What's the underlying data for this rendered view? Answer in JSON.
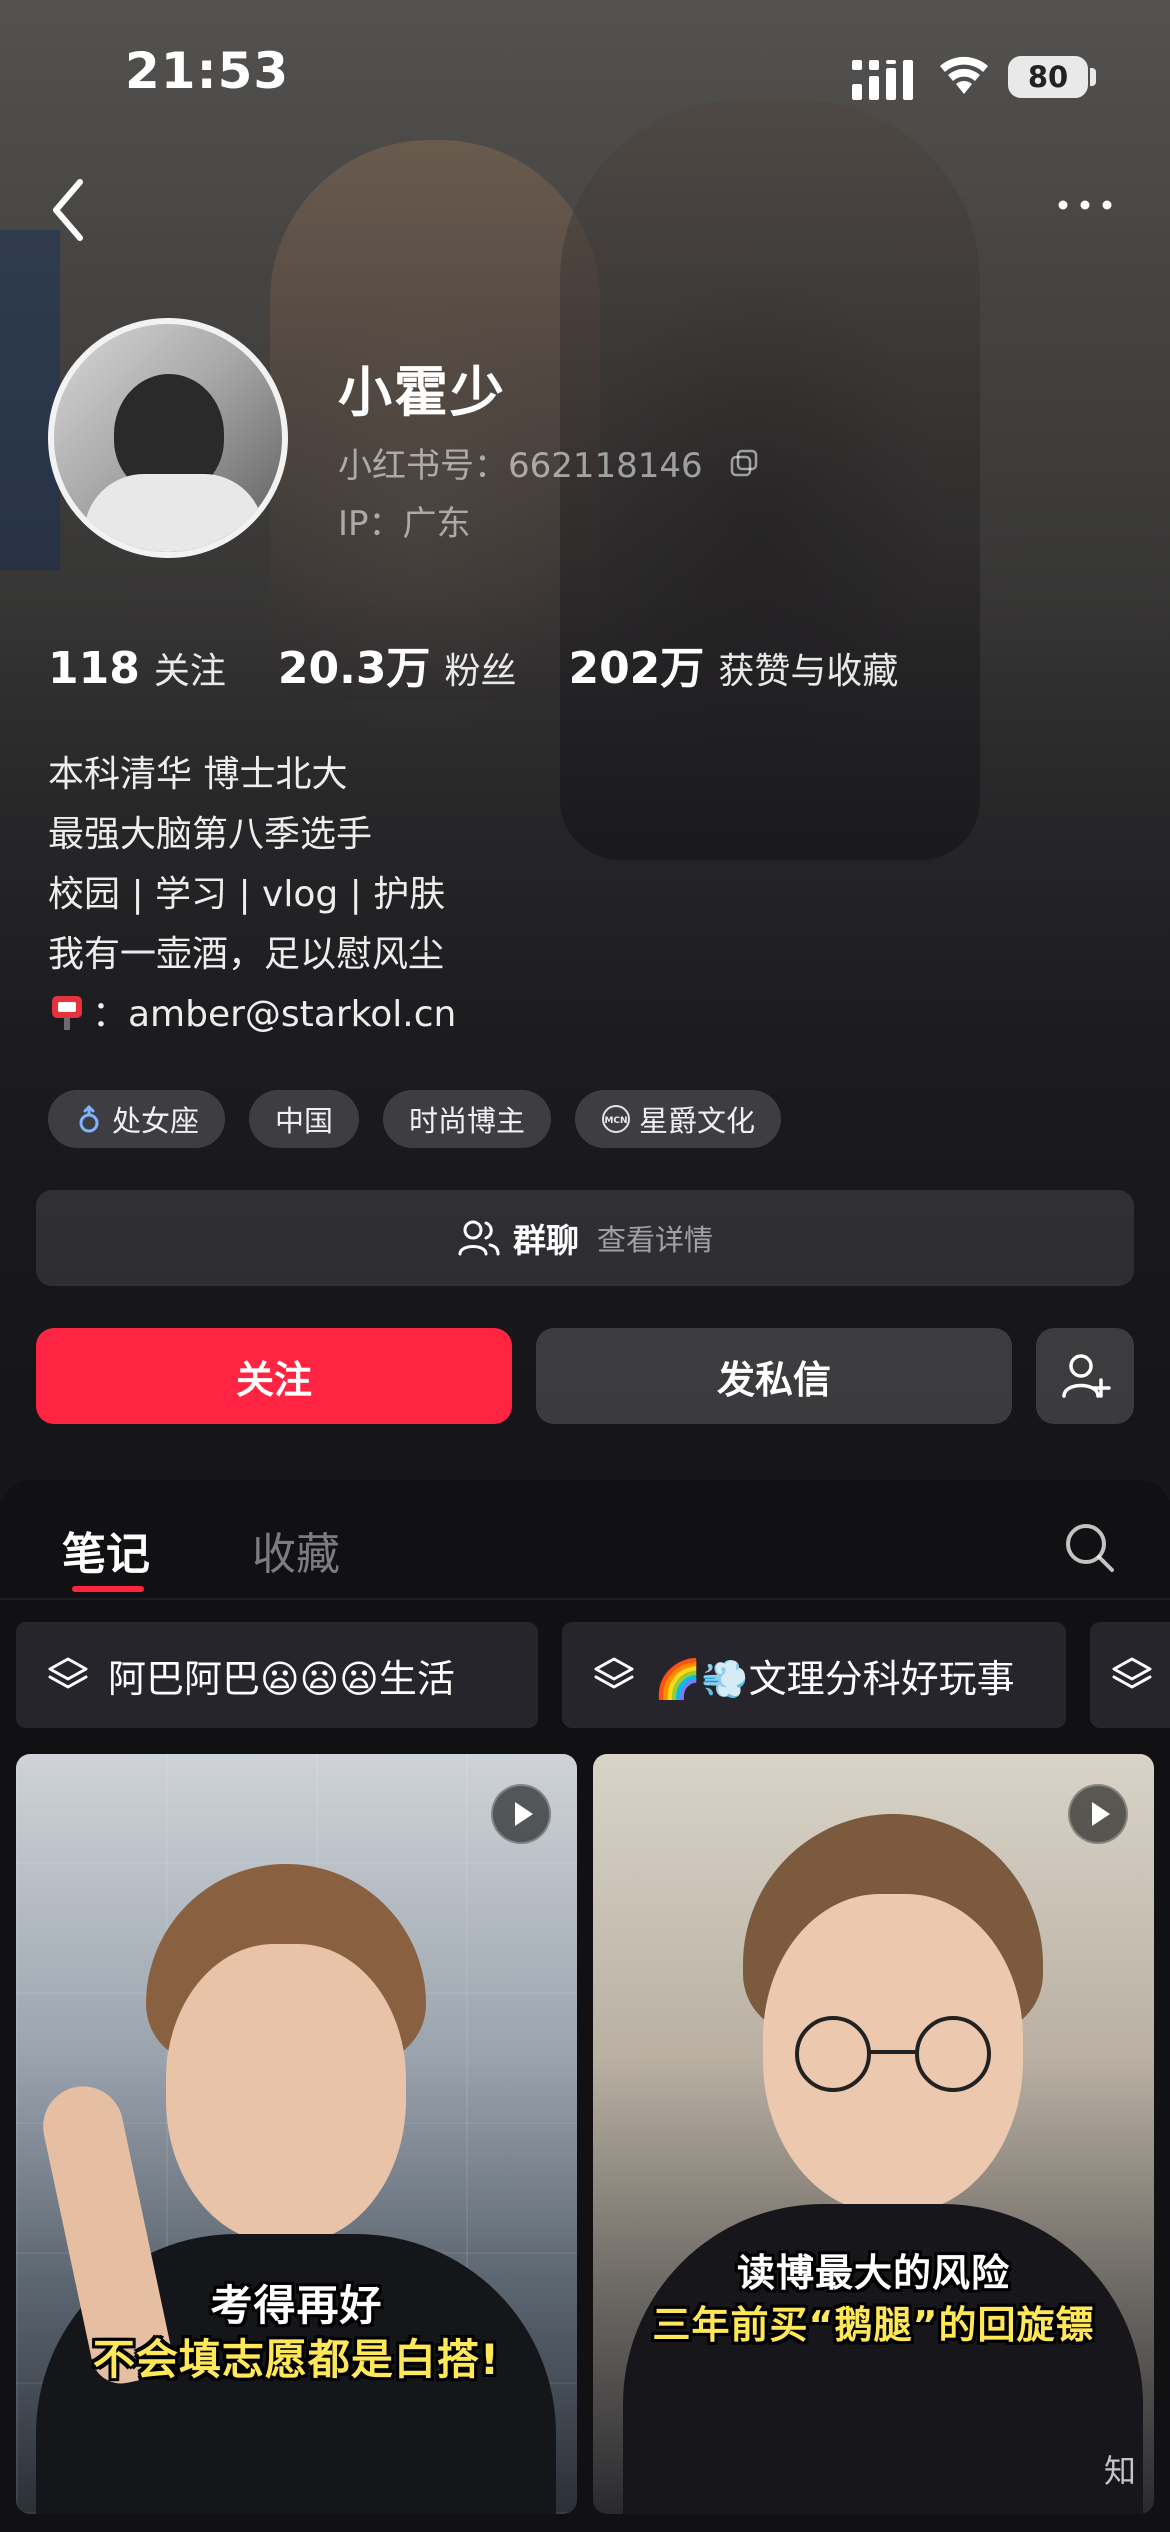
{
  "status_bar": {
    "time": "21:53",
    "battery": "80"
  },
  "profile": {
    "nickname": "小霍少",
    "red_id": "小红书号：662118146",
    "ip": "IP：广东",
    "stats": [
      {
        "value": "118",
        "label": "关注"
      },
      {
        "value": "20.3万",
        "label": "粉丝"
      },
      {
        "value": "202万",
        "label": "获赞与收藏"
      }
    ],
    "bio": [
      "本科清华 博士北大",
      "最强大脑第八季选手",
      "校园 | 学习 | vlog | 护肤",
      "我有一壶酒，足以慰风尘"
    ],
    "email": "：amber@starkol.cn",
    "tags": [
      {
        "label": "处女座",
        "icon": "virgo-icon"
      },
      {
        "label": "中国",
        "icon": ""
      },
      {
        "label": "时尚博主",
        "icon": ""
      },
      {
        "label": "星爵文化",
        "icon": "mcn-icon"
      }
    ],
    "group_chat": {
      "title": "群聊",
      "detail": "查看详情"
    },
    "actions": {
      "follow": "关注",
      "message": "发私信"
    }
  },
  "content": {
    "tabs": [
      "笔记",
      "收藏"
    ],
    "active_tab": "笔记",
    "collections": [
      "阿巴阿巴😦😦😦生活",
      "🌈💨文理分科好玩事"
    ],
    "notes": [
      {
        "caption_line1": "考得再好",
        "caption_line2": "不会填志愿都是白搭!",
        "type": "video"
      },
      {
        "caption_line1": "读博最大的风险",
        "caption_line2": "三年前买“鹅腿”的回旋镖",
        "type": "video",
        "watermark": "知"
      }
    ]
  },
  "colors": {
    "accent": "#ff2442",
    "background": "#111114"
  }
}
